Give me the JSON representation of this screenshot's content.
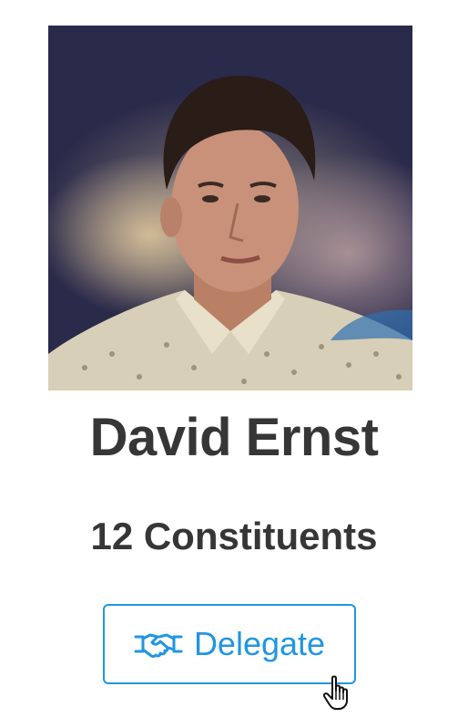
{
  "profile": {
    "name": "David Ernst",
    "constituents_label": "12 Constituents",
    "avatar_icon": "profile-photo"
  },
  "actions": {
    "delegate_label": "Delegate",
    "delegate_icon": "handshake-icon"
  },
  "colors": {
    "accent": "#2196e0",
    "text": "#363636",
    "background": "#ffffff"
  },
  "cursor": {
    "icon": "hand-pointer-icon"
  }
}
